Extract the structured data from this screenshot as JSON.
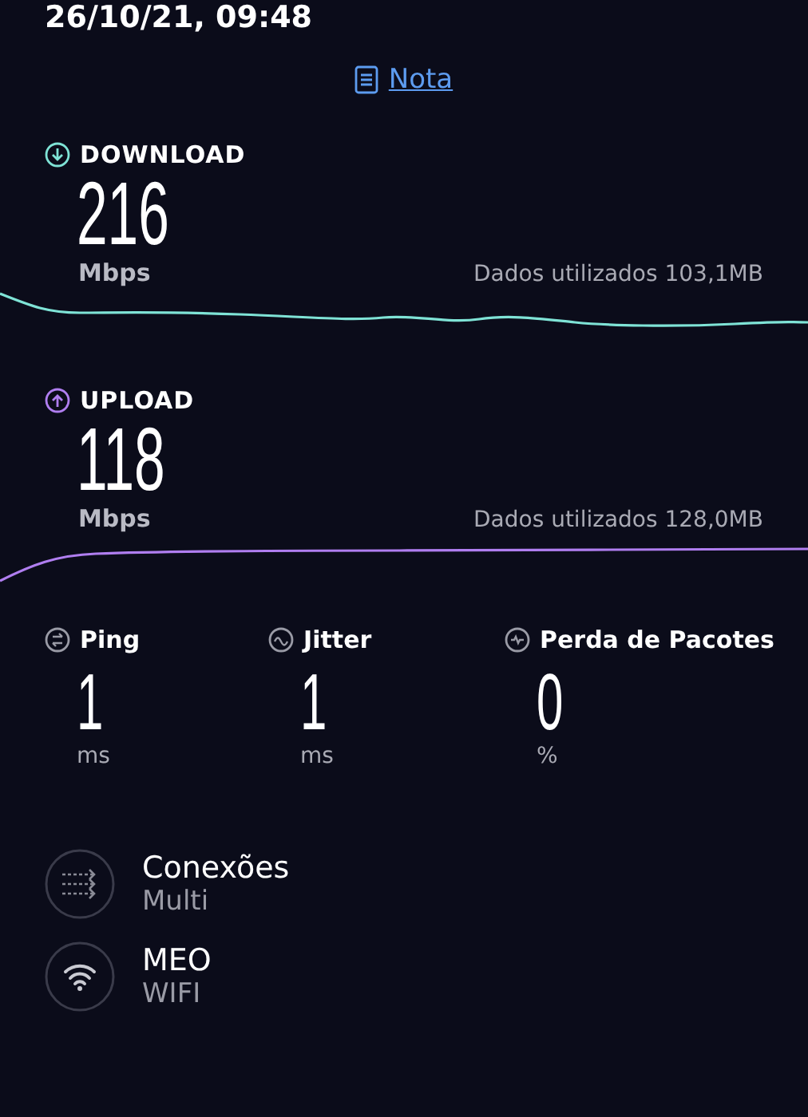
{
  "header": {
    "date": "26/10/21, 09:48",
    "note_link": "Nota"
  },
  "speeds": [
    {
      "kind": "download",
      "label": "DOWNLOAD",
      "value": "216",
      "unit": "Mbps",
      "data_used": "Dados utilizados 103,1MB",
      "color": "#7fe3d6"
    },
    {
      "kind": "upload",
      "label": "UPLOAD",
      "value": "118",
      "unit": "Mbps",
      "data_used": "Dados utilizados 128,0MB",
      "color": "#b07ef0"
    }
  ],
  "metrics": [
    {
      "kind": "ping",
      "label": "Ping",
      "value": "1",
      "unit": "ms"
    },
    {
      "kind": "jitter",
      "label": "Jitter",
      "value": "1",
      "unit": "ms"
    },
    {
      "kind": "loss",
      "label": "Perda de Pacotes",
      "value": "0",
      "unit": "%"
    }
  ],
  "details": [
    {
      "kind": "connections",
      "title": "Conexões",
      "subtitle": "Multi"
    },
    {
      "kind": "wifi",
      "title": "MEO",
      "subtitle": "WIFI"
    }
  ]
}
